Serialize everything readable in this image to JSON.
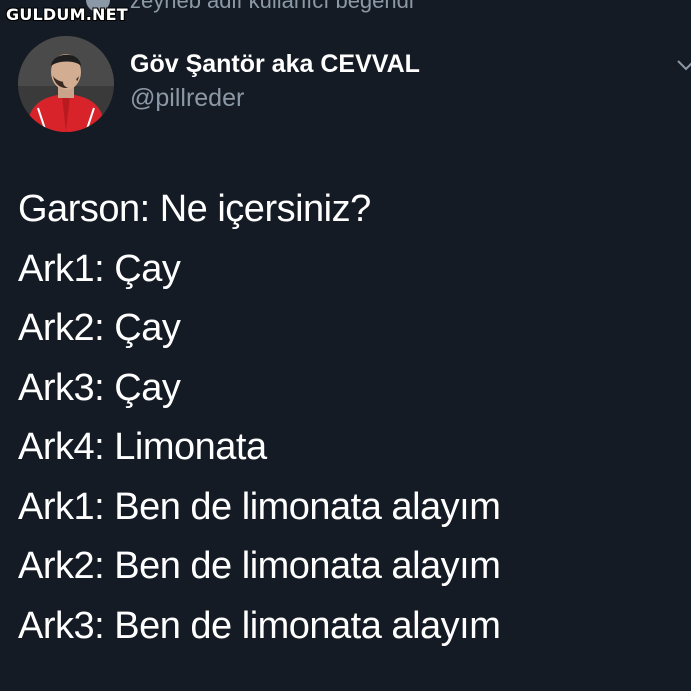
{
  "watermark": "GULDUM.NET",
  "liked_by": "zeyneb adlı kullanıcı beğendi",
  "author": {
    "display_name": "Göv Şantör aka CEVVAL",
    "handle": "@pillreder"
  },
  "icons": {
    "liked": "heart-icon",
    "menu": "chevron-down-icon",
    "avatar": "profile-photo"
  },
  "colors": {
    "background": "#151b24",
    "text": "#ffffff",
    "secondary_text": "#8b98a5",
    "avatar_jacket": "#d8232a"
  },
  "tweet": {
    "lines": [
      "Garson: Ne içersiniz?",
      "Ark1: Çay",
      "Ark2: Çay",
      "Ark3: Çay",
      "Ark4: Limonata",
      "Ark1: Ben de limonata alayım",
      "Ark2: Ben de limonata alayım",
      "Ark3: Ben de limonata alayım"
    ]
  }
}
